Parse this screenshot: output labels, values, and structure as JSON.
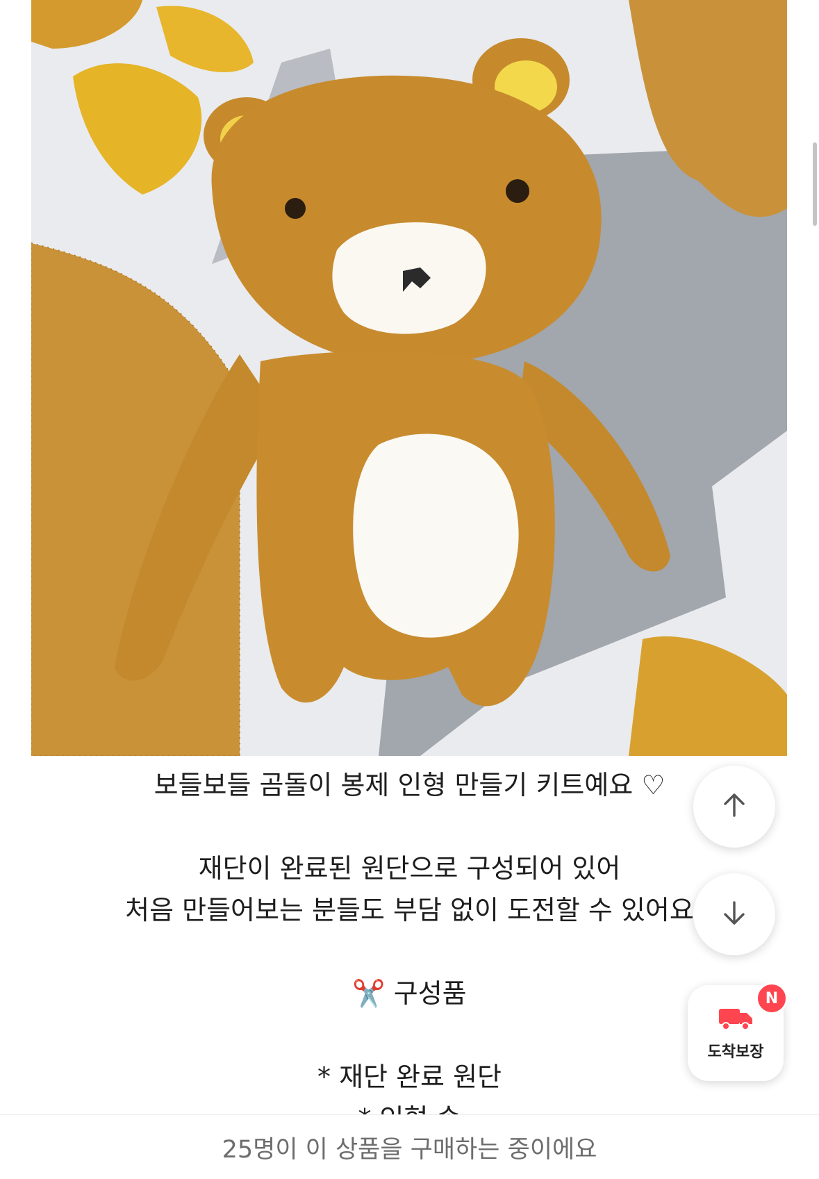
{
  "product_image": {
    "alt": ""
  },
  "description": {
    "lines": [
      "보들보들 곰돌이 봉제 인형 만들기 키트예요 ♡",
      "",
      "재단이 완료된 원단으로 구성되어 있어",
      "처음 만들어보는 분들도 부담 없이 도전할 수 있어요",
      "",
      "✂️ 구성품",
      "",
      "* 재단 완료 원단",
      "* 인형 솜"
    ]
  },
  "floating_buttons": {
    "scroll_up": "up-arrow-icon",
    "scroll_down": "down-arrow-icon",
    "delivery": {
      "label": "도착보장",
      "badge": "N",
      "icon": "truck-icon"
    }
  },
  "bottom_bar": {
    "text": "25명이 이 상품을 구매하는 중이에요"
  },
  "colors": {
    "badge": "#ff4550",
    "truck": "#ff4550",
    "text": "#1e1e1e",
    "muted": "#6d6d6d"
  }
}
